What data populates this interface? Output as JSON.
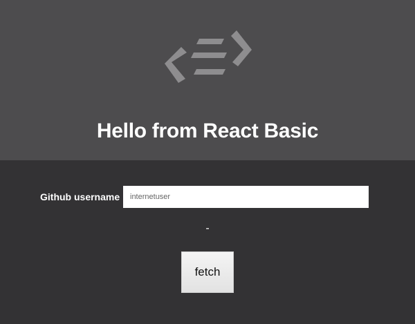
{
  "header": {
    "logo_icon": "code-brackets-logo-icon",
    "title": "Hello from React Basic"
  },
  "form": {
    "label": "Github username",
    "username_value": "internetuser",
    "status_text": "-",
    "fetch_label": "fetch"
  },
  "colors": {
    "header_bg": "#4d4c4e",
    "body_bg": "#333234",
    "logo": "#8e8d8f",
    "text": "#ffffff"
  }
}
